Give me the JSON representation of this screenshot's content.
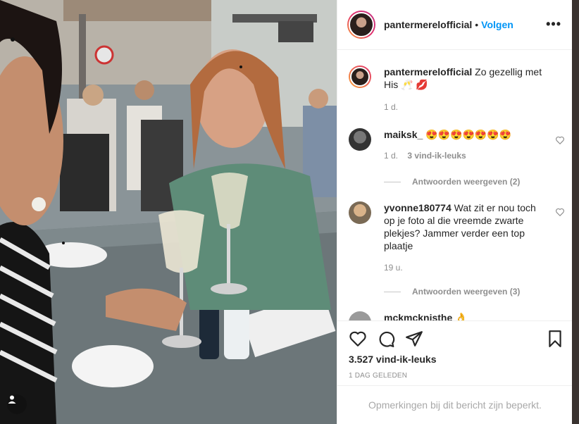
{
  "post": {
    "username": "pantermerelofficial",
    "follow_label": "Volgen",
    "header_separator": "•",
    "more_label": "•••"
  },
  "caption": {
    "username": "pantermerelofficial",
    "text": "Zo gezellig met His 🥂 💋",
    "time": "1 d."
  },
  "comments": [
    {
      "username": "maiksk_",
      "text": "😍😍😍😍😍😍😍",
      "time": "1 d.",
      "likes": "3 vind-ik-leuks",
      "replies_label": "Antwoorden weergeven (2)"
    },
    {
      "username": "yvonne180774",
      "text": "Wat zit er nou toch op je foto al die vreemde zwarte plekjes? Jammer verder een top plaatje",
      "time": "19 u.",
      "replies_label": "Antwoorden weergeven (3)"
    }
  ],
  "partial_comment": {
    "username": "mckmcknisthe",
    "text": "👌"
  },
  "footer": {
    "likes": "3.527 vind-ik-leuks",
    "posted_ago": "1 DAG GELEDEN",
    "comments_restricted": "Opmerkingen bij dit bericht zijn beperkt."
  },
  "icons": {
    "heart": "heart-icon",
    "comment": "comment-icon",
    "share": "share-icon",
    "save": "bookmark-icon",
    "tag": "user-tag-icon"
  },
  "colors": {
    "link_blue": "#0095f6",
    "muted": "#8e8e8e",
    "border": "#efefef"
  }
}
